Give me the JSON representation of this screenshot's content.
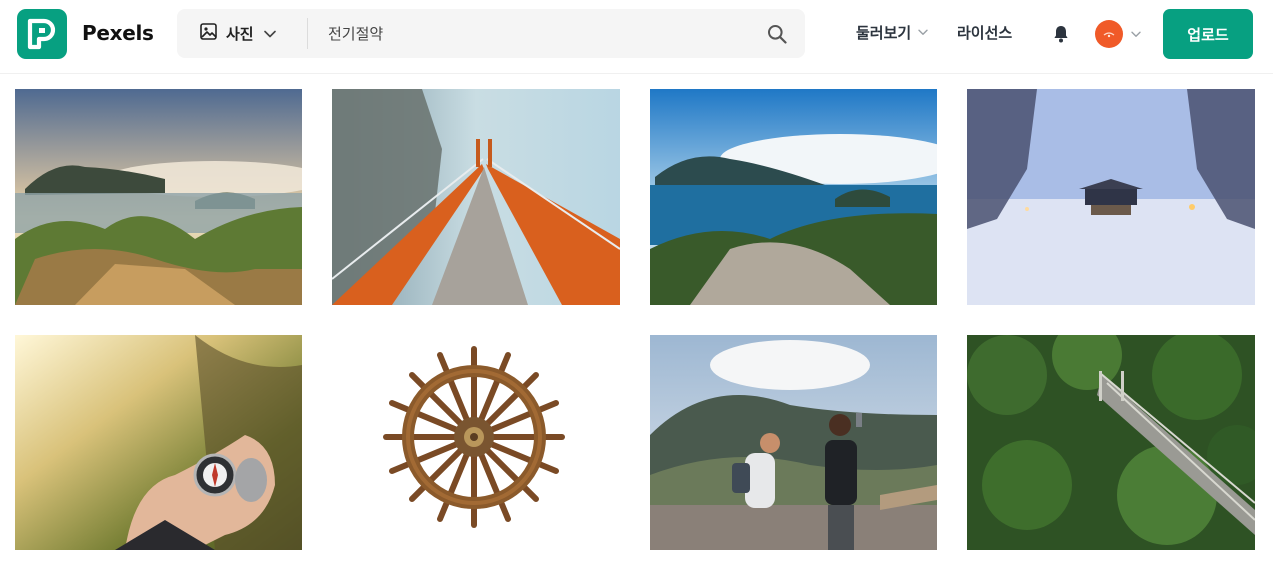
{
  "header": {
    "brand": "Pexels",
    "search": {
      "type_label": "사진",
      "value": "전기절약"
    },
    "nav": {
      "explore_label": "둘러보기",
      "license_label": "라이선스"
    },
    "upload_label": "업로드",
    "icons": {
      "logo": "pexels-logo-icon",
      "image_type": "image-icon",
      "search": "search-icon",
      "notifications": "bell-icon",
      "dropdown": "chevron-down-icon"
    }
  },
  "colors": {
    "brand": "#07a081",
    "avatar": "#f05a28",
    "search_bg": "#f5f5f5"
  },
  "photos": [
    {
      "subject": "island sea of clouds at sunrise from rocky peak"
    },
    {
      "subject": "orange suspension bridge in fog"
    },
    {
      "subject": "blue bay with islands and clouds"
    },
    {
      "subject": "snowy temple in winter forest"
    },
    {
      "subject": "hand holding compass in valley"
    },
    {
      "subject": "wooden ship steering wheel"
    },
    {
      "subject": "two hikers taking selfie on mountain"
    },
    {
      "subject": "suspension bridge over green forest"
    }
  ]
}
